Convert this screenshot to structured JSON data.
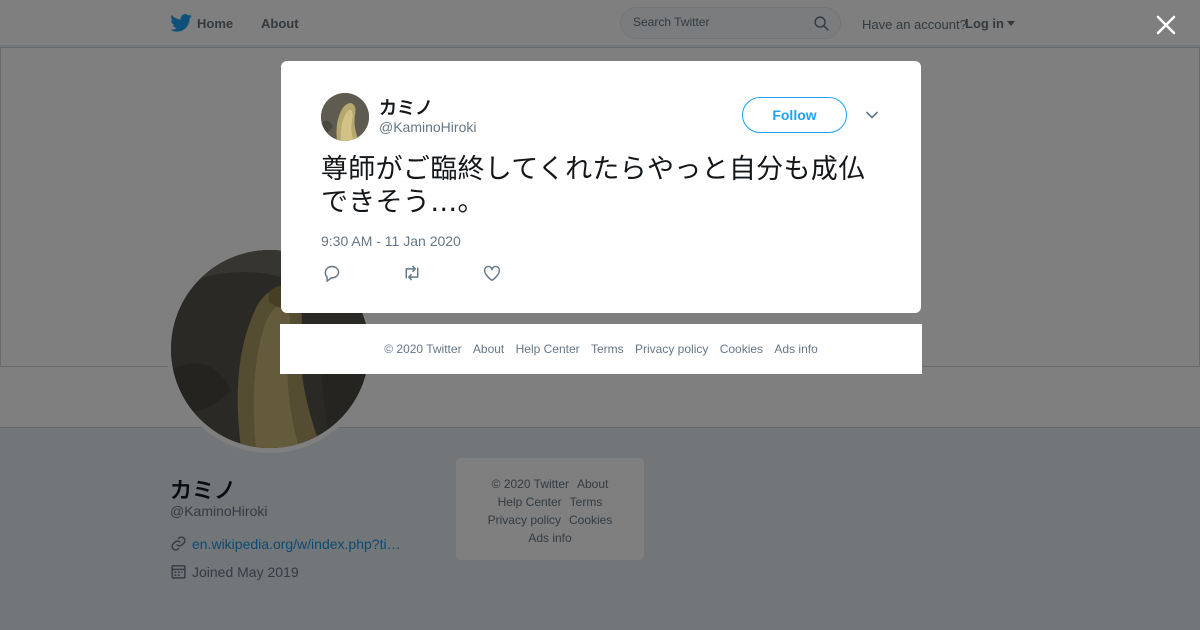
{
  "nav": {
    "home_label": "Home",
    "about_label": "About",
    "search_placeholder": "Search Twitter",
    "have_account": "Have an account?",
    "login_label": "Log in",
    "brand_color": "#1da1f2"
  },
  "profile": {
    "name": "カミノ",
    "handle": "@KaminoHiroki",
    "url": "en.wikipedia.org/w/index.php?ti…",
    "joined": "Joined May 2019"
  },
  "side_footer": {
    "links": [
      "© 2020 Twitter",
      "About",
      "Help Center",
      "Terms",
      "Privacy policy",
      "Cookies",
      "Ads info"
    ]
  },
  "tweet": {
    "name": "カミノ",
    "handle": "@KaminoHiroki",
    "follow_label": "Follow",
    "text": "尊師がご臨終してくれたらやっと自分も成仏できそう…。",
    "timestamp": "9:30 AM - 11 Jan 2020",
    "actions": [
      "reply-icon",
      "retweet-icon",
      "heart-icon"
    ]
  },
  "modal_footer": {
    "links": [
      "© 2020 Twitter",
      "About",
      "Help Center",
      "Terms",
      "Privacy policy",
      "Cookies",
      "Ads info"
    ]
  },
  "icons": {
    "close": "close-icon",
    "caret": "chevron-down-icon"
  }
}
